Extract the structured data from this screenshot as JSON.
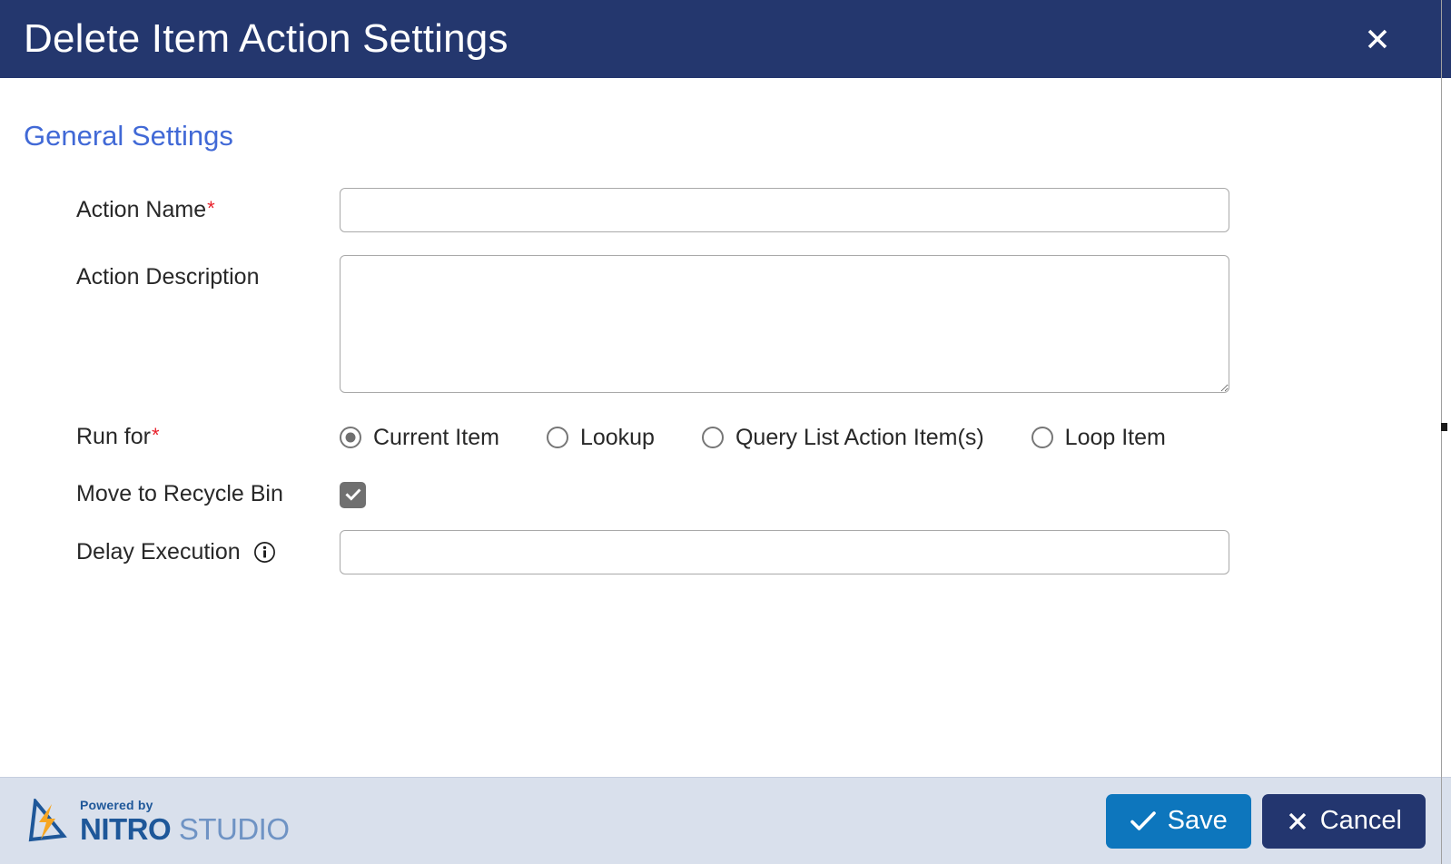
{
  "header": {
    "title": "Delete Item Action Settings",
    "close_icon": "close-icon",
    "background": "#24376e"
  },
  "body": {
    "section_heading": "General Settings",
    "section_heading_color": "#4169d6",
    "fields": {
      "action_name": {
        "label": "Action Name",
        "required": true,
        "required_marker": "*",
        "value": "",
        "placeholder": ""
      },
      "action_description": {
        "label": "Action Description",
        "required": false,
        "value": "",
        "placeholder": ""
      },
      "run_for": {
        "label": "Run for",
        "required": true,
        "required_marker": "*",
        "selected": "Current Item",
        "options": [
          {
            "label": "Current Item",
            "selected": true
          },
          {
            "label": "Lookup",
            "selected": false
          },
          {
            "label": "Query List Action Item(s)",
            "selected": false
          },
          {
            "label": "Loop Item",
            "selected": false
          }
        ]
      },
      "move_to_recycle_bin": {
        "label": "Move to Recycle Bin",
        "checked": true,
        "check_icon": "check-icon"
      },
      "delay_execution": {
        "label": "Delay Execution",
        "info_icon": "info-icon",
        "value": "",
        "placeholder": ""
      }
    }
  },
  "footer": {
    "brand": {
      "logo_icon": "nitro-bolt-logo-icon",
      "powered_by": "Powered by",
      "name_bold": "NITRO",
      "name_light": " STUDIO"
    },
    "save_button": {
      "label": "Save",
      "icon": "check-icon",
      "color": "#0d76bd"
    },
    "cancel_button": {
      "label": "Cancel",
      "icon": "close-icon",
      "color": "#23366f"
    }
  }
}
